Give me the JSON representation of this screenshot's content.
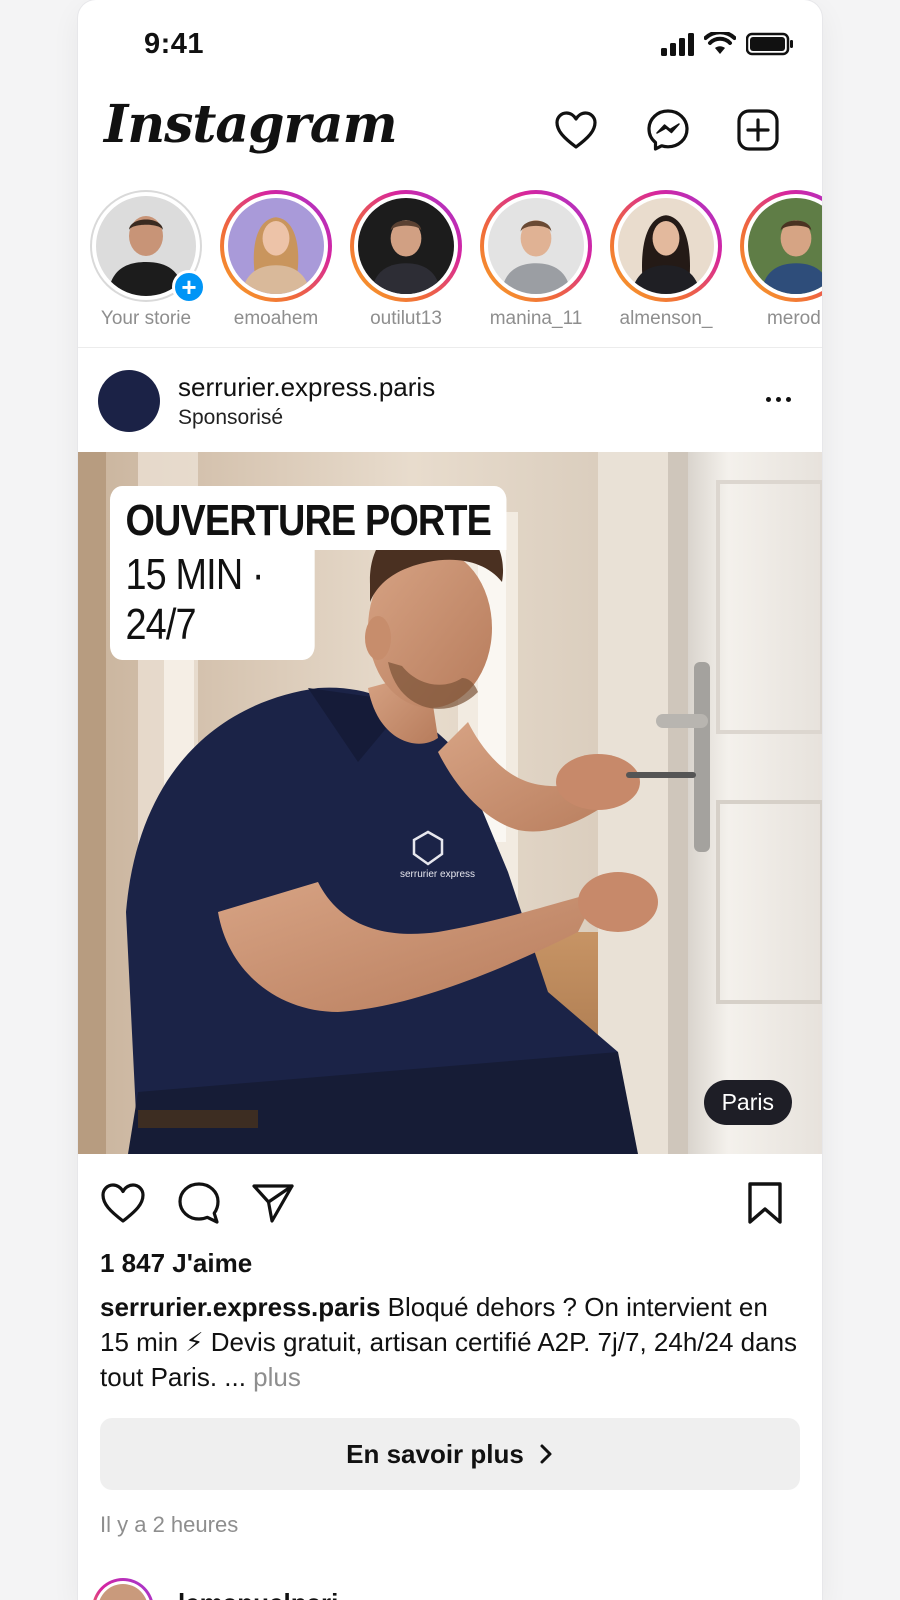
{
  "status_bar": {
    "time": "9:41"
  },
  "header": {
    "logo": "Instagram"
  },
  "stories": [
    {
      "label": "Your storie",
      "own": true
    },
    {
      "label": "emoahem"
    },
    {
      "label": "outilut13"
    },
    {
      "label": "manina_11"
    },
    {
      "label": "almenson_"
    },
    {
      "label": "merodi"
    }
  ],
  "post": {
    "username": "serrurier.express.paris",
    "sponsored": "Sponsorisé",
    "image": {
      "headline": "OUVERTURE PORTE",
      "subline": "15 MIN · 24/7",
      "location_badge": "Paris",
      "shirt_logo_text": "serrurier express"
    },
    "likes": "1 847 J'aime",
    "caption_user": "serrurier.express.paris",
    "caption_text": " Bloqué dehors ? On intervient en 15 min ⚡ Devis gratuit, artisan certifié A2P. 7j/7, 24h/24 dans tout Paris. ...",
    "caption_more": " plus",
    "cta_label": "En savoir plus",
    "time_ago": "Il y a 2 heures"
  },
  "next_post": {
    "username": "lemanuelpari"
  },
  "colors": {
    "accent": "#0095f6",
    "brand_navy": "#1b2246",
    "muted": "#8e8e8e"
  }
}
